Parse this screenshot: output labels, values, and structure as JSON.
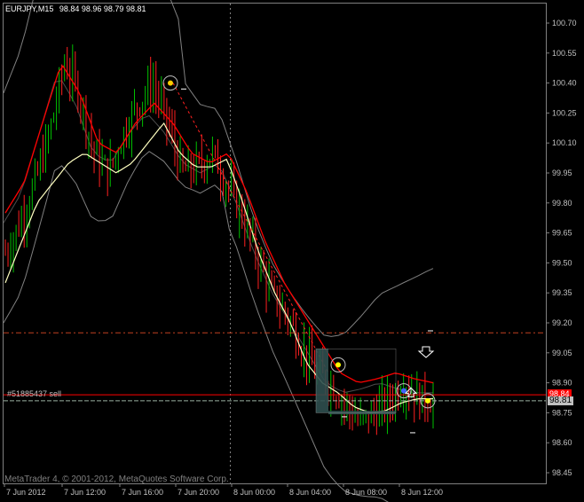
{
  "window": {
    "symbol_timeframe": "EURJPY,M15",
    "ohlc_text": "98.84 98.96 98.79 98.81",
    "copyright": "MetaTrader 4, © 2001-2012, MetaQuotes Software Corp."
  },
  "order_label": "#51885437 sell",
  "price_tags": {
    "bid": "98.81",
    "order": "98.84"
  },
  "colors": {
    "background": "#000000",
    "bull_candle": "#00c000",
    "bear_candle": "#ff2020",
    "ma_fast": "#ffffc0",
    "ma_slow": "#ff0000",
    "bollinger": "#808080",
    "grid": "#404040",
    "order_line": "#ff0000",
    "stop_line": "#c04020",
    "bid_line": "#9ab0a0",
    "rect_fill": "#2f4f4f"
  },
  "chart_data": {
    "type": "candlestick",
    "y_axis_ticks": [
      "100.70",
      "100.55",
      "100.40",
      "100.25",
      "100.10",
      "99.95",
      "99.80",
      "99.65",
      "99.50",
      "99.35",
      "99.20",
      "99.05",
      "98.90",
      "98.75",
      "98.60",
      "98.45"
    ],
    "x_axis_ticks": [
      "7 Jun 2012",
      "7 Jun 12:00",
      "7 Jun 16:00",
      "7 Jun 20:00",
      "8 Jun 00:00",
      "8 Jun 04:00",
      "8 Jun 08:00",
      "8 Jun 12:00"
    ],
    "ylim": [
      98.4,
      100.78
    ],
    "current_bid": 98.81,
    "order_price": 98.84,
    "stop_level": 99.15,
    "close_path": [
      99.55,
      99.7,
      99.9,
      100.15,
      100.5,
      100.35,
      100.05,
      99.95,
      100.15,
      100.3,
      100.4,
      100.2,
      99.95,
      99.98,
      100.05,
      99.9,
      99.75,
      99.55,
      99.35,
      99.25,
      99.1,
      98.95,
      98.9,
      98.8,
      98.7,
      98.75,
      98.8,
      98.9,
      98.82,
      98.81
    ],
    "ma_fast_path": [
      99.4,
      99.6,
      99.8,
      99.9,
      100.0,
      100.05,
      100.0,
      99.95,
      100.0,
      100.1,
      100.2,
      100.05,
      99.98,
      99.98,
      100.02,
      99.8,
      99.55,
      99.35,
      99.2,
      99.0,
      98.9,
      98.85,
      98.78,
      98.75,
      98.76,
      98.8,
      98.82,
      98.82
    ],
    "ma_slow_path": [
      99.75,
      99.9,
      100.2,
      100.5,
      100.35,
      100.1,
      100.05,
      100.2,
      100.3,
      100.2,
      100.05,
      100.0,
      100.05,
      99.85,
      99.6,
      99.4,
      99.25,
      99.1,
      98.95,
      98.9,
      98.92,
      98.95,
      98.92,
      98.9
    ]
  }
}
